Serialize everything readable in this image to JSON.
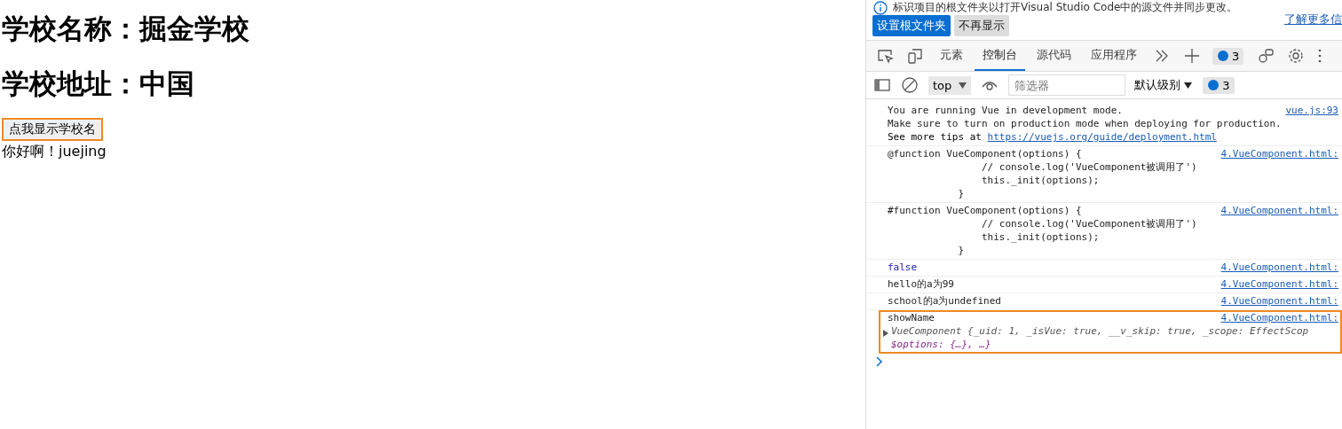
{
  "page": {
    "headings": [
      "学校名称：掘金学校",
      "学校地址：中国"
    ],
    "button": {
      "label": "点我显示学校名",
      "highlighted": true
    },
    "greeting": "你好啊！juejing"
  },
  "devtools": {
    "infobar": {
      "text": "标识项目的根文件夹以打开Visual Studio Code中的源文件并同步更改。",
      "link": "了解更多信",
      "buttons": [
        {
          "label": "设置根文件夹",
          "primary": true
        },
        {
          "label": "不再显示",
          "primary": false
        }
      ]
    },
    "tabs": [
      {
        "label": "元素",
        "selected": false
      },
      {
        "label": "控制台",
        "selected": true
      },
      {
        "label": "源代码",
        "selected": false
      },
      {
        "label": "应用程序",
        "selected": false
      }
    ],
    "issues_count": "3",
    "context": "top",
    "filter": {
      "placeholder": "筛选器"
    },
    "level_menu": "默认级别",
    "filter_issues_count": "3",
    "messages": [
      {
        "kind": "text",
        "lines": [
          "You are running Vue in development mode.",
          "Make sure to turn on production mode when deploying for production."
        ],
        "prefix": "See more tips at ",
        "url": "https://vuejs.org/guide/deployment.html",
        "source": "vue.js:93",
        "highlighted": false
      },
      {
        "kind": "code",
        "lines": [
          "@function VueComponent(options) {",
          "                // console.log('VueComponent被调用了')",
          "                this._init(options);",
          "            }"
        ],
        "source": "4.VueComponent.html:",
        "highlighted": false
      },
      {
        "kind": "code",
        "lines": [
          "#function VueComponent(options) {",
          "                // console.log('VueComponent被调用了')",
          "                this._init(options);",
          "            }"
        ],
        "source": "4.VueComponent.html:",
        "highlighted": false
      },
      {
        "kind": "boolean",
        "lines": [
          "false"
        ],
        "source": "4.VueComponent.html:",
        "highlighted": false
      },
      {
        "kind": "code",
        "lines": [
          "hello的a为99"
        ],
        "source": "4.VueComponent.html:",
        "highlighted": false
      },
      {
        "kind": "code",
        "lines": [
          "school的a为undefined"
        ],
        "source": "4.VueComponent.html:",
        "highlighted": false
      },
      {
        "kind": "object",
        "lines": [
          "showName"
        ],
        "object_preview": "VueComponent {_uid: 1, _isVue: true, __v_skip: true, _scope: EffectScop",
        "object_more": "$options: {…}, …}",
        "expanded": false,
        "source": "4.VueComponent.html:",
        "highlighted": true
      }
    ]
  }
}
